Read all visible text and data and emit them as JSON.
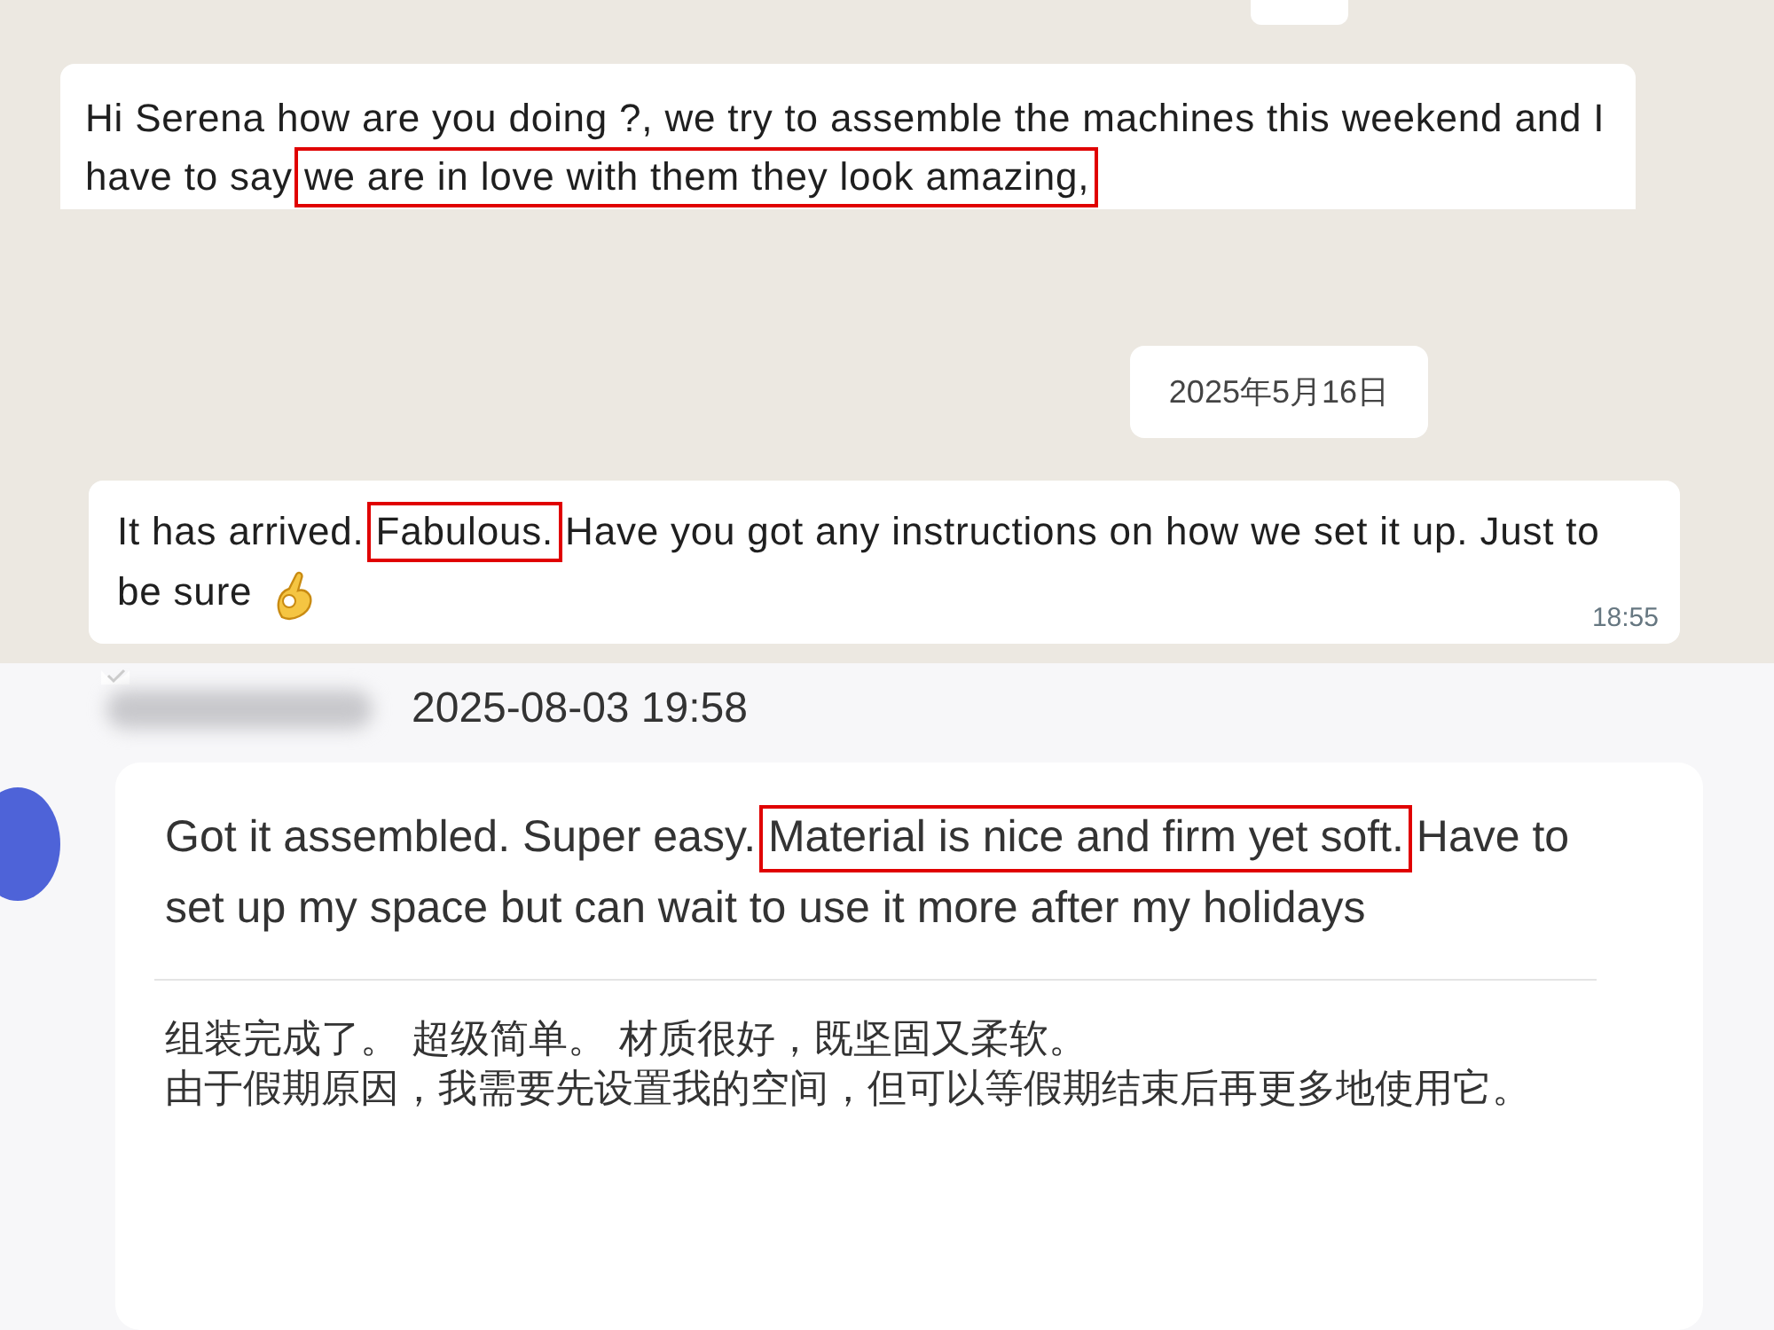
{
  "chat": {
    "messages": [
      {
        "segments": [
          {
            "text": "Hi Serena how are you doing ?, we try to assemble the machines this weekend and I have to say ",
            "highlighted": false
          },
          {
            "text": "we are in love with them they look amazing,",
            "highlighted": true
          }
        ]
      },
      {
        "date": "2025年5月16日"
      },
      {
        "segments": [
          {
            "text": "It has arrived. ",
            "highlighted": false
          },
          {
            "text": "Fabulous.",
            "highlighted": true
          },
          {
            "text": " Have you got any instructions on how we set it up. Just to be sure ",
            "highlighted": false
          }
        ],
        "time": "18:55"
      }
    ]
  },
  "review": {
    "date": "2025-08-03 19:58",
    "segments": [
      {
        "text": "Got it assembled. Super easy. ",
        "highlighted": false
      },
      {
        "text": "Material is nice and firm yet soft.",
        "highlighted": true
      },
      {
        "text": " Have to set up my space but can wait to use it more after my holidays",
        "highlighted": false
      }
    ],
    "translation": [
      "组装完成了。 超级简单。 材质很好，既坚固又柔软。",
      "由于假期原因，我需要先设置我的空间，但可以等假期结束后再更多地使用它。"
    ]
  }
}
